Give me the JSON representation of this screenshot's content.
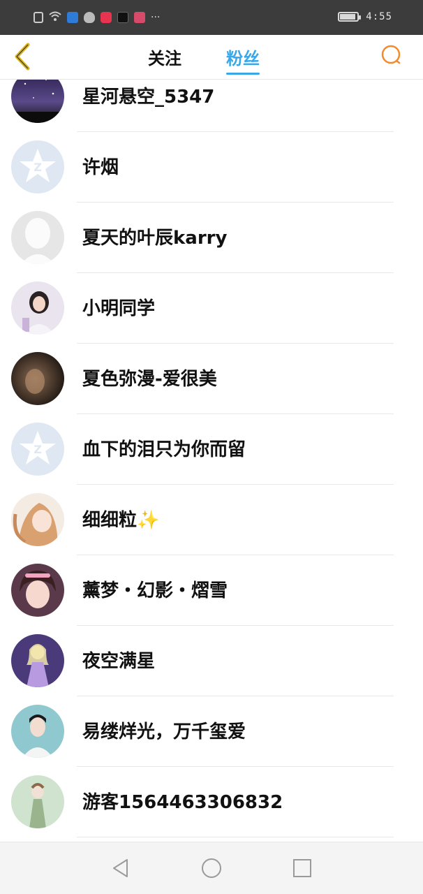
{
  "status_bar": {
    "time": "4:55",
    "left_icons": [
      "alert-icon",
      "wifi-icon",
      "shield-app-icon",
      "qq-icon",
      "music-app-icon",
      "tiktok-icon",
      "calendar-app-icon",
      "more-icon"
    ],
    "overflow": "···"
  },
  "header": {
    "tabs": [
      {
        "label": "关注",
        "active": false
      },
      {
        "label": "粉丝",
        "active": true
      }
    ],
    "accent_color": "#3aa7e8",
    "back_color": "#d8b21a",
    "search_color": "#f28a30"
  },
  "followers": [
    {
      "name": "星河悬空_5347",
      "avatar": "starry-sky"
    },
    {
      "name": "许烟",
      "avatar": "default-qzone"
    },
    {
      "name": "夏天的叶辰karry",
      "avatar": "default-silhouette"
    },
    {
      "name": "小明同学",
      "avatar": "girl-photo"
    },
    {
      "name": "夏色弥漫-爱很美",
      "avatar": "dark-photo"
    },
    {
      "name": "血下的泪只为你而留",
      "avatar": "default-qzone"
    },
    {
      "name": "细细粒✨",
      "avatar": "anime-girl"
    },
    {
      "name": "薰梦・幻影・熠雪",
      "avatar": "girl-selfie"
    },
    {
      "name": "夜空满星",
      "avatar": "purple-princess"
    },
    {
      "name": "易缕烊光，万千玺爱",
      "avatar": "teal-photo"
    },
    {
      "name": "游客1564463306832",
      "avatar": "green-girl"
    }
  ]
}
